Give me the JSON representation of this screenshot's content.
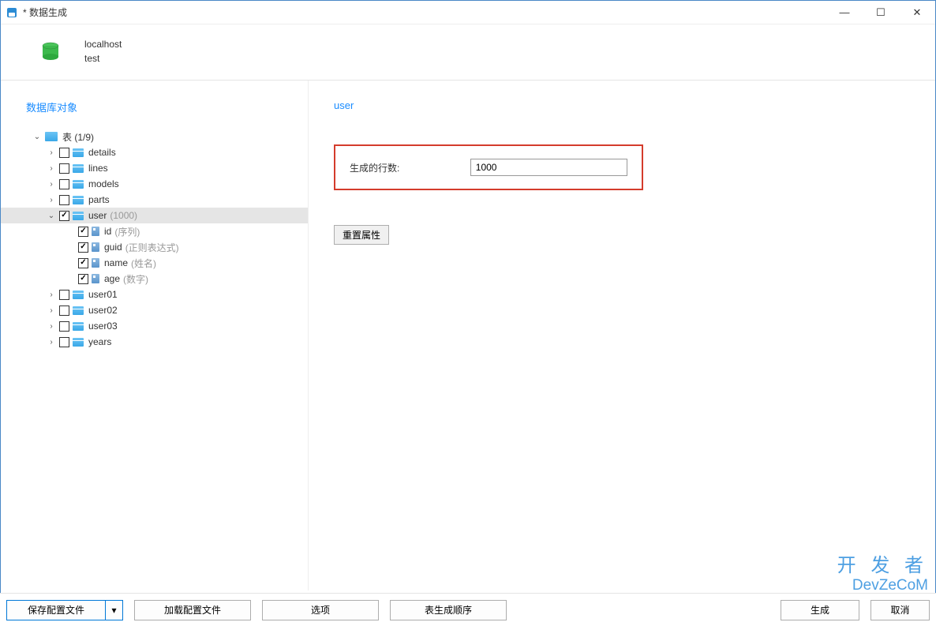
{
  "window": {
    "title": "* 数据生成"
  },
  "connection": {
    "host": "localhost",
    "database": "test"
  },
  "sidebar": {
    "heading": "数据库对象",
    "root": {
      "label": "表",
      "count_suffix": "(1/9)"
    },
    "tables": [
      {
        "name": "details",
        "checked": false,
        "expanded": false
      },
      {
        "name": "lines",
        "checked": false,
        "expanded": false
      },
      {
        "name": "models",
        "checked": false,
        "expanded": false
      },
      {
        "name": "parts",
        "checked": false,
        "expanded": false
      },
      {
        "name": "user",
        "checked": true,
        "expanded": true,
        "suffix": "(1000)",
        "selected": true,
        "columns": [
          {
            "name": "id",
            "checked": true,
            "suffix": "(序列)"
          },
          {
            "name": "guid",
            "checked": true,
            "suffix": "(正则表达式)"
          },
          {
            "name": "name",
            "checked": true,
            "suffix": "(姓名)"
          },
          {
            "name": "age",
            "checked": true,
            "suffix": "(数字)"
          }
        ]
      },
      {
        "name": "user01",
        "checked": false,
        "expanded": false
      },
      {
        "name": "user02",
        "checked": false,
        "expanded": false
      },
      {
        "name": "user03",
        "checked": false,
        "expanded": false
      },
      {
        "name": "years",
        "checked": false,
        "expanded": false
      }
    ]
  },
  "content": {
    "title": "user",
    "rows_label": "生成的行数:",
    "rows_value": "1000",
    "reset_label": "重置属性"
  },
  "footer": {
    "save": "保存配置文件",
    "load": "加载配置文件",
    "options": "选项",
    "order": "表生成顺序",
    "generate": "生成",
    "cancel": "取消"
  },
  "watermark": {
    "line1": "开 发 者",
    "line2": "DevZeCoM"
  }
}
